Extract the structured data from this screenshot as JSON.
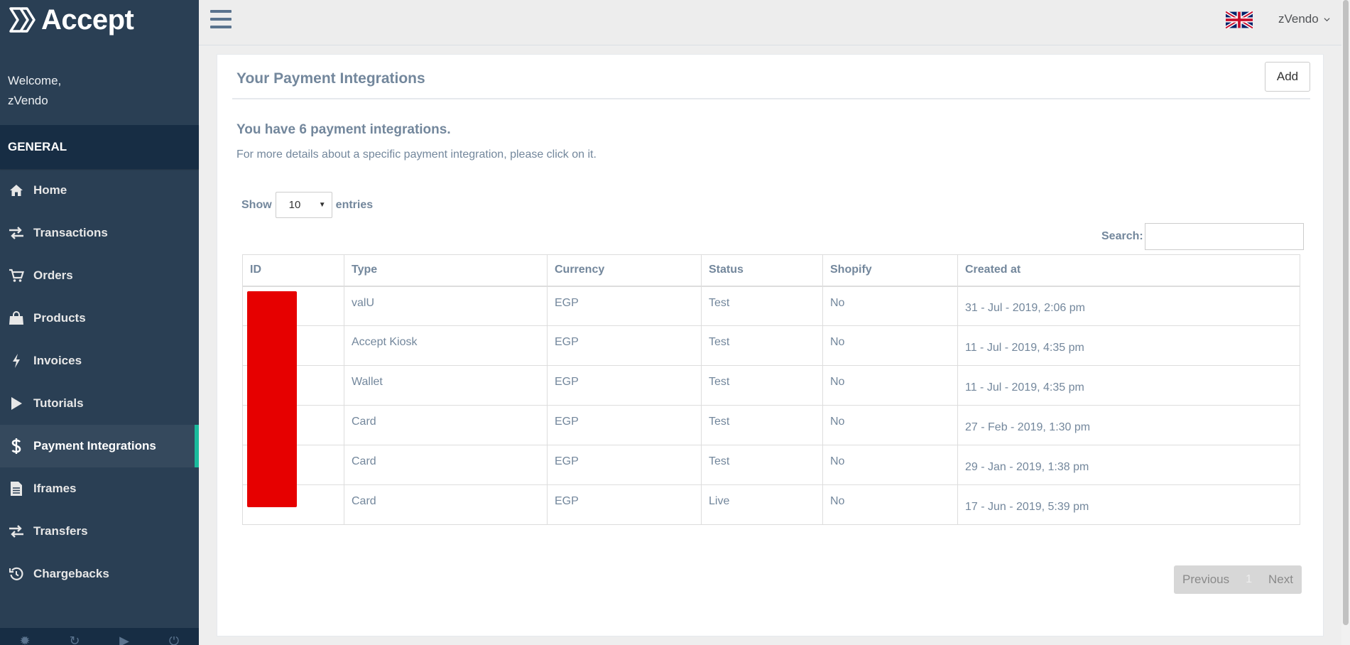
{
  "brand": {
    "name": "Accept"
  },
  "welcome": {
    "greeting": "Welcome,",
    "username": "zVendo"
  },
  "sidebar": {
    "section_title": "GENERAL",
    "items": [
      {
        "label": "Home",
        "icon": "home-icon"
      },
      {
        "label": "Transactions",
        "icon": "exchange-icon"
      },
      {
        "label": "Orders",
        "icon": "shopping-cart-icon"
      },
      {
        "label": "Products",
        "icon": "shopping-bag-icon"
      },
      {
        "label": "Invoices",
        "icon": "bolt-icon"
      },
      {
        "label": "Tutorials",
        "icon": "play-icon"
      },
      {
        "label": "Payment Integrations",
        "icon": "dollar-icon",
        "active": true
      },
      {
        "label": "Iframes",
        "icon": "file-text-icon"
      },
      {
        "label": "Transfers",
        "icon": "exchange-icon"
      },
      {
        "label": "Chargebacks",
        "icon": "history-icon"
      }
    ],
    "footer_icons": [
      "settings-icon",
      "refresh-icon",
      "play-icon",
      "power-icon"
    ]
  },
  "topbar": {
    "user_name": "zVendo",
    "flag_icon": "uk-flag-icon",
    "menu_icon": "hamburger-icon"
  },
  "panel": {
    "title": "Your Payment Integrations",
    "add_label": "Add",
    "count_heading": "You have 6 payment integrations.",
    "hint": "For more details about a specific payment integration, please click on it."
  },
  "table_controls": {
    "show_label": "Show",
    "entries_value": "10",
    "entries_label": "entries",
    "search_label": "Search:",
    "search_value": ""
  },
  "table": {
    "columns": [
      "ID",
      "Type",
      "Currency",
      "Status",
      "Shopify",
      "Created at"
    ],
    "rows": [
      {
        "id": "",
        "type": "valU",
        "currency": "EGP",
        "status": "Test",
        "shopify": "No",
        "created": "31 - Jul - 2019, 2:06 pm"
      },
      {
        "id": "",
        "type": "Accept Kiosk",
        "currency": "EGP",
        "status": "Test",
        "shopify": "No",
        "created": "11 - Jul - 2019, 4:35 pm"
      },
      {
        "id": "",
        "type": "Wallet",
        "currency": "EGP",
        "status": "Test",
        "shopify": "No",
        "created": "11 - Jul - 2019, 4:35 pm"
      },
      {
        "id": "",
        "type": "Card",
        "currency": "EGP",
        "status": "Test",
        "shopify": "No",
        "created": "27 - Feb - 2019, 1:30 pm"
      },
      {
        "id": "",
        "type": "Card",
        "currency": "EGP",
        "status": "Test",
        "shopify": "No",
        "created": "29 - Jan - 2019, 1:38 pm"
      },
      {
        "id": "",
        "type": "Card",
        "currency": "EGP",
        "status": "Live",
        "shopify": "No",
        "created": "17 - Jun - 2019, 5:39 pm"
      }
    ]
  },
  "pagination": {
    "previous_label": "Previous",
    "current_page": "1",
    "next_label": "Next"
  },
  "colors": {
    "sidebar_bg": "#2a3f54",
    "section_bg": "#172d44",
    "accent": "#1abb9c",
    "text": "#73879c",
    "redaction": "#e60000"
  }
}
